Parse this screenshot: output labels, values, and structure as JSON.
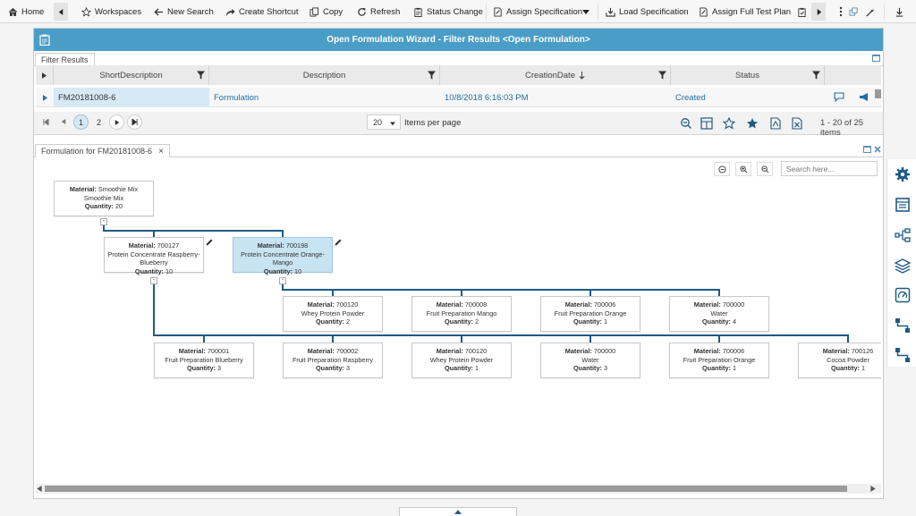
{
  "toolbar": {
    "home": "Home",
    "workspaces": "Workspaces",
    "new_search": "New Search",
    "create_shortcut": "Create Shortcut",
    "copy": "Copy",
    "refresh": "Refresh",
    "status_change": "Status Change",
    "assign_specification": "Assign Specification",
    "load_specification": "Load Specification",
    "assign_full_test_plan": "Assign Full Test Plan"
  },
  "wizard": {
    "title": "Open Formulation Wizard - Filter Results <Open Formulation>"
  },
  "filter_results": {
    "tab_label": "Filter Results",
    "columns": [
      "ShortDescription",
      "Description",
      "CreationDate",
      "Status"
    ],
    "row": {
      "short_description": "FM20181008-6",
      "description": "Formulation",
      "creation_date": "10/8/2018 6:16:03 PM",
      "status": "Created"
    },
    "pager": {
      "pages": [
        "1",
        "2"
      ],
      "current_page": "1",
      "page_size": "20",
      "items_per_page_label": "Items per page",
      "range_text": "1 - 20 of 25 items"
    }
  },
  "formulation_tab": {
    "label": "Formulation for FM20181008-6",
    "close": "×"
  },
  "tree": {
    "search_placeholder": "Search here...",
    "material_label": "Material:",
    "quantity_label": "Quantity:",
    "collapse_symbol": "-",
    "root": {
      "material": "Smoothie Mix",
      "name": "Smoothie Mix",
      "quantity": "20"
    },
    "level1": [
      {
        "material": "700127",
        "name": "Protein Concentrate Raspberry-Blueberry",
        "quantity": "10"
      },
      {
        "material": "700198",
        "name": "Protein Concentrate Orange-Mango",
        "quantity": "10"
      }
    ],
    "level2_orange_mango": [
      {
        "material": "700120",
        "name": "Whey Protein Powder",
        "quantity": "2"
      },
      {
        "material": "700008",
        "name": "Fruit Preparation Mango",
        "quantity": "2"
      },
      {
        "material": "700006",
        "name": "Fruit Preparation Orange",
        "quantity": "1"
      },
      {
        "material": "700000",
        "name": "Water",
        "quantity": "4"
      }
    ],
    "level2_raspberry_blueberry": [
      {
        "material": "700001",
        "name": "Fruit Preparation Blueberry",
        "quantity": "3"
      },
      {
        "material": "700002",
        "name": "Fruit Preparation Raspberry",
        "quantity": "3"
      },
      {
        "material": "700120",
        "name": "Whey Protein Powder",
        "quantity": "1"
      },
      {
        "material": "700000",
        "name": "Water",
        "quantity": "3"
      },
      {
        "material": "700006",
        "name": "Fruit Preparation Orange",
        "quantity": "1"
      },
      {
        "material": "700126",
        "name": "Cocoa Powder",
        "quantity": "1"
      }
    ]
  },
  "colors": {
    "title_bar": "#4a9dc7",
    "connector": "#1e5a85",
    "selected_node": "#c8e3f2",
    "link_text": "#1d6fa5"
  }
}
